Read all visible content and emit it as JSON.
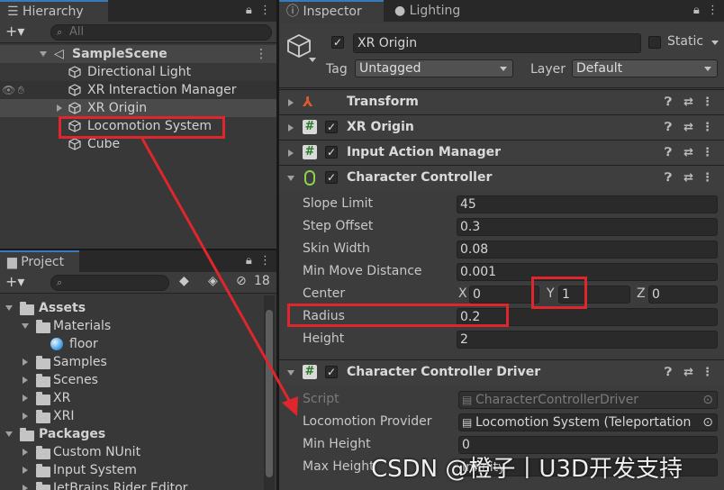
{
  "hierarchy": {
    "tab_label": "Hierarchy",
    "add_label": "+▾",
    "search_placeholder": "All",
    "scene_name": "SampleScene",
    "items": [
      {
        "label": "Directional Light"
      },
      {
        "label": "XR Interaction Manager"
      },
      {
        "label": "XR Origin"
      },
      {
        "label": "Locomotion System"
      },
      {
        "label": "Cube"
      }
    ]
  },
  "project": {
    "tab_label": "Project",
    "add_label": "+▾",
    "hidden_count": "18",
    "tree": [
      {
        "label": "Assets"
      },
      {
        "label": "Materials"
      },
      {
        "label": "floor"
      },
      {
        "label": "Samples"
      },
      {
        "label": "Scenes"
      },
      {
        "label": "XR"
      },
      {
        "label": "XRI"
      },
      {
        "label": "Packages"
      },
      {
        "label": "Custom NUnit"
      },
      {
        "label": "Input System"
      },
      {
        "label": "JetBrains Rider Editor"
      }
    ]
  },
  "inspector": {
    "tab_label": "Inspector",
    "lighting_tab_label": "Lighting",
    "object_name": "XR Origin",
    "static_label": "Static",
    "tag_label": "Tag",
    "tag_value": "Untagged",
    "layer_label": "Layer",
    "layer_value": "Default",
    "components": {
      "transform": "Transform",
      "xr_origin": "XR Origin",
      "input_action_manager": "Input Action Manager",
      "character_controller": "Character Controller",
      "character_controller_driver": "Character Controller Driver"
    },
    "cc_fields": [
      {
        "label": "Slope Limit",
        "value": "45"
      },
      {
        "label": "Step Offset",
        "value": "0.3"
      },
      {
        "label": "Skin Width",
        "value": "0.08"
      },
      {
        "label": "Min Move Distance",
        "value": "0.001"
      },
      {
        "label": "Center",
        "value": ""
      },
      {
        "label": "Radius",
        "value": "0.2"
      },
      {
        "label": "Height",
        "value": "2"
      }
    ],
    "center": {
      "x_label": "X",
      "x": "0",
      "y_label": "Y",
      "y": "1",
      "z_label": "Z",
      "z": "0"
    },
    "driver_fields": [
      {
        "label": "Script",
        "value": "CharacterControllerDriver"
      },
      {
        "label": "Locomotion Provider",
        "value": "Locomotion System (Teleportation"
      },
      {
        "label": "Min Height",
        "value": "0"
      },
      {
        "label": "Max Height",
        "value": "Infinity"
      }
    ]
  },
  "watermark": "CSDN @橙子丨U3D开发支持",
  "colors": {
    "highlight": "#e0262d",
    "accent": "#3a79bb"
  }
}
